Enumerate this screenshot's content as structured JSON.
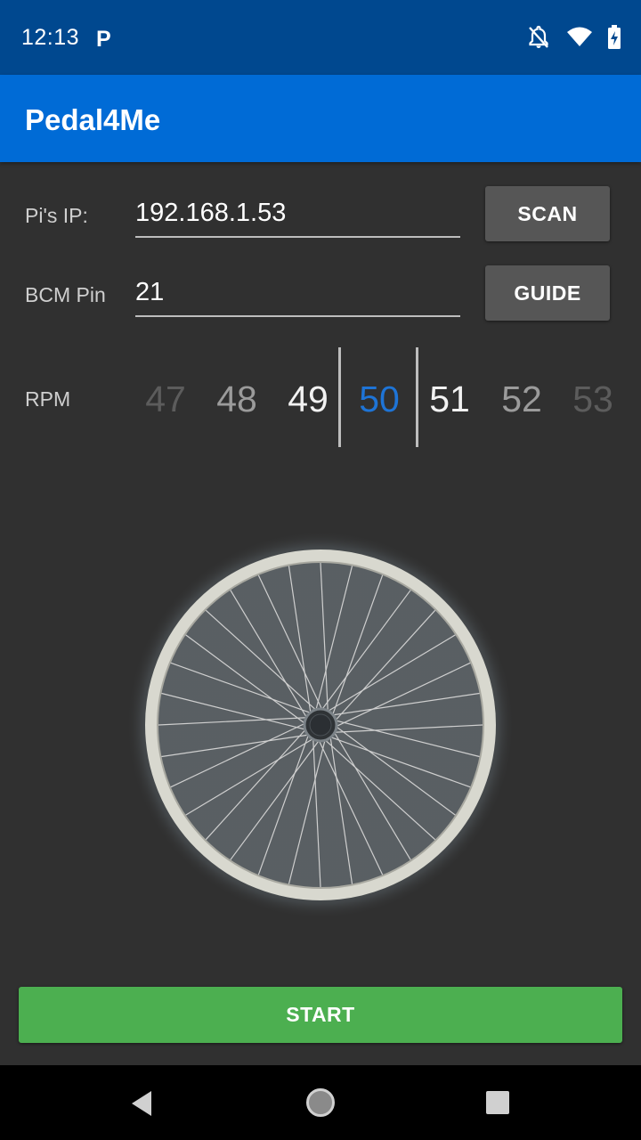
{
  "status_bar": {
    "time": "12:13",
    "notification_glyph": "P",
    "icons": [
      "notifications-off-icon",
      "wifi-icon",
      "battery-charging-icon"
    ]
  },
  "app_bar": {
    "title": "Pedal4Me"
  },
  "form": {
    "ip_label": "Pi's IP:",
    "ip_value": "192.168.1.53",
    "scan_label": "SCAN",
    "pin_label": "BCM Pin",
    "pin_value": "21",
    "guide_label": "GUIDE"
  },
  "rpm": {
    "label": "RPM",
    "values": [
      "47",
      "48",
      "49",
      "50",
      "51",
      "52",
      "53"
    ],
    "selected": "50",
    "selected_color": "#1e74d6"
  },
  "wheel": {
    "icon": "bicycle-wheel-icon"
  },
  "actions": {
    "start_label": "START",
    "start_color": "#4caf50"
  },
  "nav_bar": {
    "icons": [
      "back-icon",
      "home-icon",
      "recents-icon"
    ]
  },
  "colors": {
    "status_bar": "#00488f",
    "app_bar": "#006bd6",
    "background": "#303030"
  }
}
